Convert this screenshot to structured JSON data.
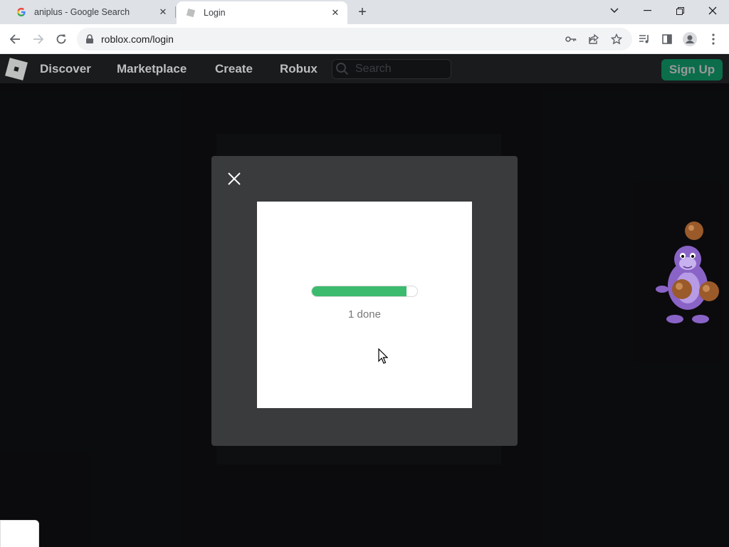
{
  "browser": {
    "tabs": [
      {
        "title": "aniplus - Google Search",
        "favicon": "google-g-icon",
        "active": false
      },
      {
        "title": "Login",
        "favicon": "roblox-page-icon",
        "active": true
      }
    ],
    "url": "roblox.com/login"
  },
  "roblox_nav": {
    "links": [
      "Discover",
      "Marketplace",
      "Create",
      "Robux"
    ],
    "search_placeholder": "Search",
    "signup_label": "Sign Up",
    "signup_color": "#00b06f"
  },
  "modal": {
    "progress_fraction": 0.9,
    "progress_text": "1 done",
    "progress_color": "#3cba6e"
  }
}
